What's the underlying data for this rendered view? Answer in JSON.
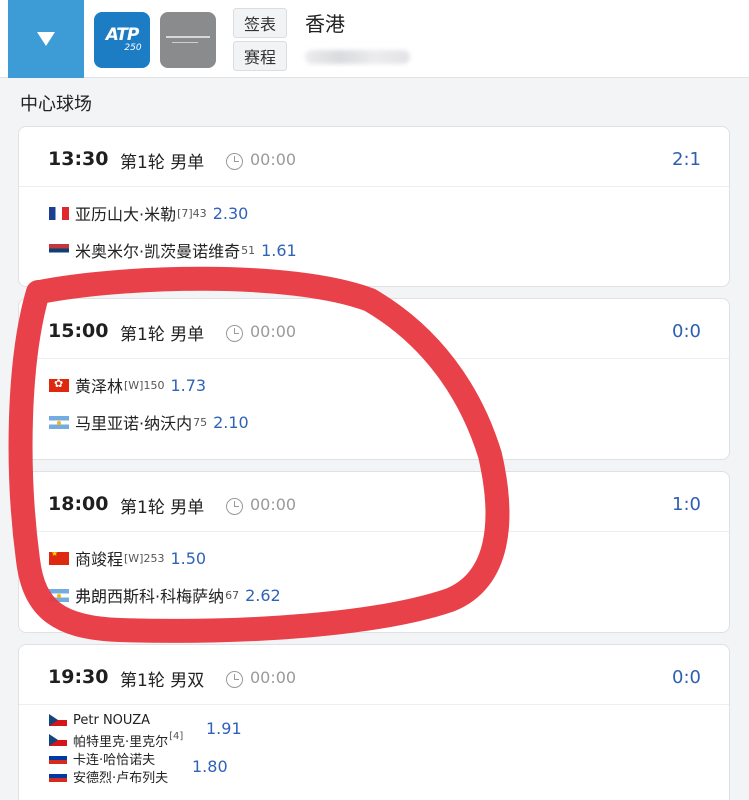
{
  "header": {
    "toggle_icon": "triangle-down-icon",
    "atp_logo_text": "ATP",
    "atp_logo_sub": "250",
    "draw_label": "签表",
    "schedule_label": "赛程",
    "city": "香港"
  },
  "court": "中心球场",
  "matches": [
    {
      "time": "13:30",
      "round": "第1轮 男单",
      "clock": "00:00",
      "score": "2:1",
      "players": [
        {
          "flag": "fr",
          "name": "亚历山大·米勒",
          "rank": "[7]43",
          "odds": "2.30"
        },
        {
          "flag": "rs",
          "name": "米奥米尔·凯茨曼诺维奇",
          "rank": "51",
          "odds": "1.61"
        }
      ]
    },
    {
      "time": "15:00",
      "round": "第1轮 男单",
      "clock": "00:00",
      "score": "0:0",
      "players": [
        {
          "flag": "hk",
          "name": "黄泽林",
          "rank": "[W]150",
          "odds": "1.73"
        },
        {
          "flag": "ar",
          "name": "马里亚诺·纳沃内",
          "rank": "75",
          "odds": "2.10"
        }
      ]
    },
    {
      "time": "18:00",
      "round": "第1轮 男单",
      "clock": "00:00",
      "score": "1:0",
      "players": [
        {
          "flag": "cn",
          "name": "商竣程",
          "rank": "[W]253",
          "odds": "1.50"
        },
        {
          "flag": "ar",
          "name": "弗朗西斯科·科梅萨纳",
          "rank": "67",
          "odds": "2.62"
        }
      ]
    },
    {
      "time": "19:30",
      "round": "第1轮 男双",
      "clock": "00:00",
      "score": "0:0",
      "teams": [
        {
          "players": [
            {
              "flag": "cz",
              "name": "Petr NOUZA",
              "rank": ""
            },
            {
              "flag": "cz",
              "name": "帕特里克·里克尔",
              "rank": "[4]"
            }
          ],
          "odds": "1.91"
        },
        {
          "players": [
            {
              "flag": "ru",
              "name": "卡连·哈恰诺夫",
              "rank": ""
            },
            {
              "flag": "ru",
              "name": "安德烈·卢布列夫",
              "rank": ""
            }
          ],
          "odds": "1.80"
        }
      ]
    }
  ],
  "colors": {
    "accent_blue": "#3d9bd6",
    "score_blue": "#2f5fb3",
    "annotation_red": "#e8373f"
  }
}
